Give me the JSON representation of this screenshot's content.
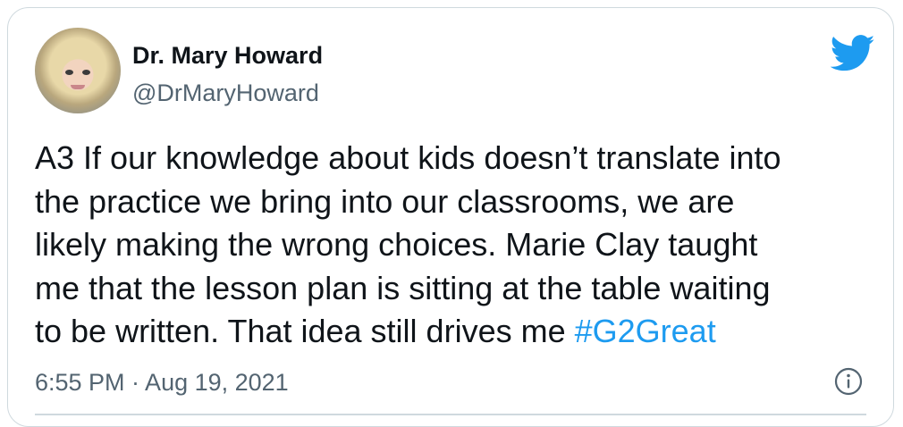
{
  "author": {
    "name": "Dr. Mary Howard",
    "handle": "@DrMaryHoward",
    "avatar": "profile-photo"
  },
  "tweet": {
    "lines": [
      "A3 If our knowledge about kids doesn’t translate into",
      "the practice we bring into our classrooms, we are",
      "likely making the wrong choices. Marie Clay taught",
      "me that the lesson plan is sitting at the table waiting"
    ],
    "last_line_text": "to be written. That idea still drives me ",
    "hashtag": "#G2Great"
  },
  "timestamp": "6:55 PM · Aug 19, 2021",
  "icons": {
    "brand": "twitter-bird-icon",
    "info": "info-icon"
  },
  "colors": {
    "brand_blue": "#1d9bf0",
    "text": "#0f1419",
    "secondary_text": "#536471",
    "border": "#cfd9de"
  }
}
